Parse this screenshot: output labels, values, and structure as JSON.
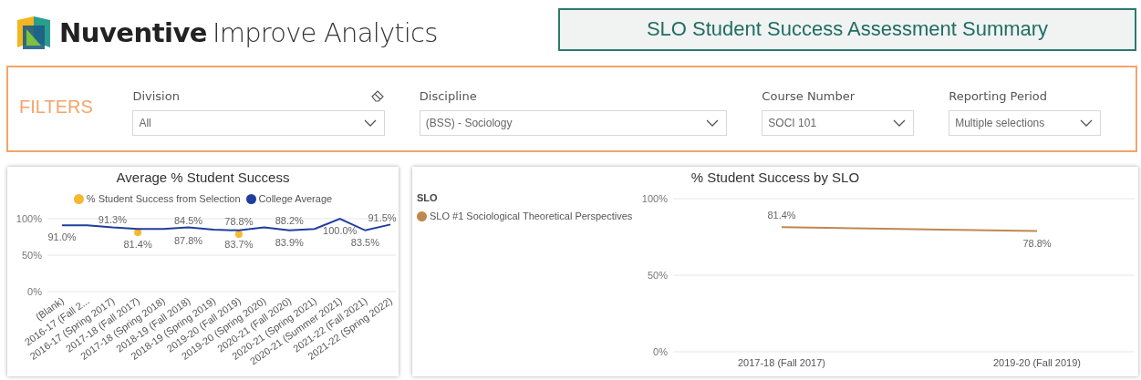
{
  "header": {
    "brand_name": "Nuventive",
    "brand_product": "Improve Analytics",
    "title": "SLO Student Success Assessment Summary"
  },
  "filters": {
    "heading": "FILTERS",
    "items": [
      {
        "label": "Division",
        "value": "All",
        "clearable": true
      },
      {
        "label": "Discipline",
        "value": "(BSS) - Sociology",
        "clearable": false
      },
      {
        "label": "Course Number",
        "value": "SOCI 101",
        "clearable": false
      },
      {
        "label": "Reporting Period",
        "value": "Multiple selections",
        "clearable": false
      }
    ]
  },
  "charts": [
    {
      "chart_data": {
        "type": "line",
        "title": "Average % Student Success",
        "categories": [
          "(Blank)",
          "2016-17 (Fall 2...",
          "2016-17 (Spring 2017)",
          "2017-18 (Fall 2017)",
          "2017-18 (Spring 2018)",
          "2018-19 (Fall 2018)",
          "2018-19 (Spring 2019)",
          "2019-20 (Fall 2019)",
          "2019-20 (Spring 2020)",
          "2020-21 (Fall 2020)",
          "2020-21 (Spring 2021)",
          "2020-21 (Summer 2021)",
          "2021-22 (Fall 2021)",
          "2021-22 (Spring 2022)"
        ],
        "series": [
          {
            "name": "% Student Success from Selection",
            "color": "#f5b82e",
            "type": "scatter",
            "values": [
              null,
              null,
              null,
              81.4,
              null,
              null,
              null,
              78.8,
              null,
              null,
              null,
              null,
              null,
              null
            ]
          },
          {
            "name": "College Average",
            "color": "#1f3e9e",
            "values": [
              91,
              91,
              88,
              86,
              86,
              88,
              85,
              84,
              88,
              84,
              86,
              100,
              84,
              92
            ]
          }
        ],
        "ylim": [
          0,
          100
        ],
        "yticks": [
          {
            "value": 0,
            "label": "0%"
          },
          {
            "value": 50,
            "label": "50%"
          },
          {
            "value": 100,
            "label": "100%"
          }
        ],
        "annotations": [
          "91.0%",
          "91.3%",
          "81.4%",
          "84.5%",
          "87.8%",
          "78.8%",
          "83.7%",
          "88.2%",
          "83.9%",
          "100.0%",
          "83.5%",
          "91.5%"
        ]
      }
    },
    {
      "legend_title": "SLO",
      "chart_data": {
        "type": "line",
        "title": "% Student Success by SLO",
        "categories": [
          "2017-18 (Fall 2017)",
          "2019-20 (Fall 2019)"
        ],
        "series": [
          {
            "name": "SLO #1 Sociological Theoretical Perspectives",
            "color": "#c0874f",
            "values": [
              81.4,
              78.8
            ]
          }
        ],
        "ylim": [
          0,
          100
        ],
        "yticks": [
          {
            "value": 0,
            "label": "0%"
          },
          {
            "value": 50,
            "label": "50%"
          },
          {
            "value": 100,
            "label": "100%"
          }
        ],
        "annotations": [
          "81.4%",
          "78.8%"
        ]
      }
    }
  ]
}
